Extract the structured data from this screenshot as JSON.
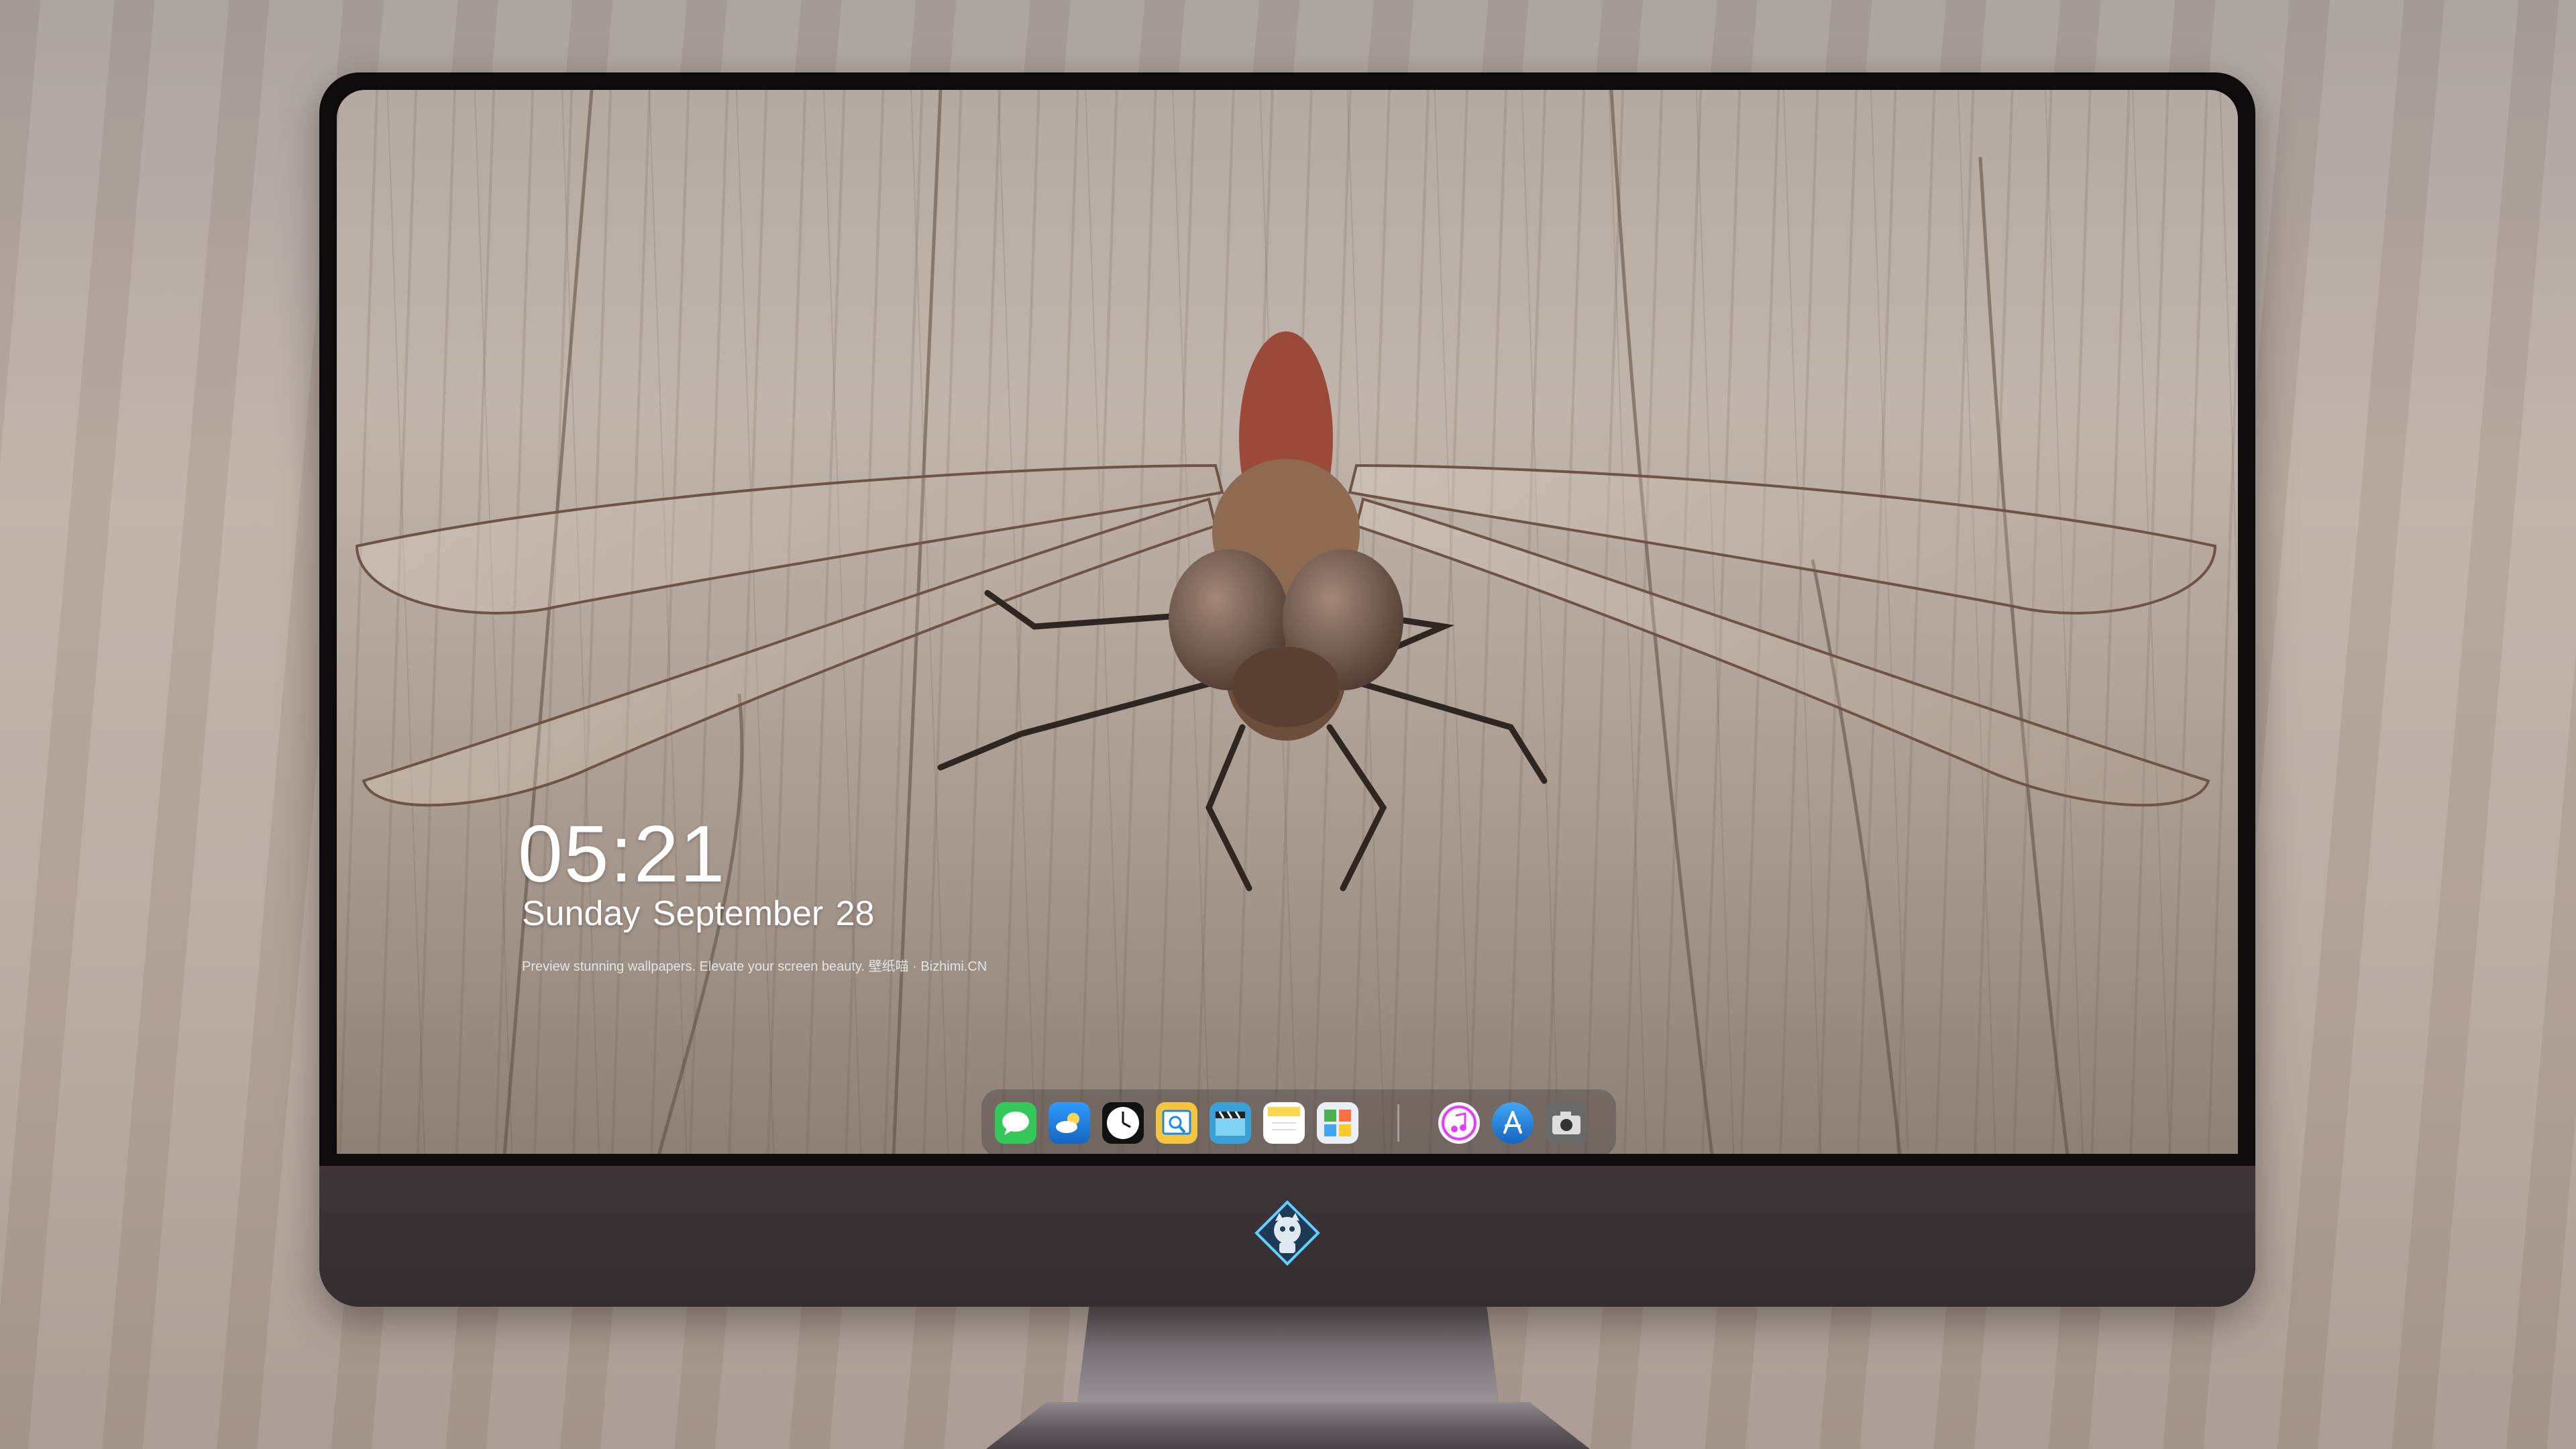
{
  "lock_screen": {
    "time": "05:21",
    "date": "Sunday September   28",
    "caption": "Preview stunning wallpapers. Elevate your screen beauty. 壁纸喵 · Bizhimi.CN"
  },
  "dock": {
    "apps": [
      {
        "name": "Messages",
        "icon": "messages-icon",
        "color": "#34c759"
      },
      {
        "name": "Weather",
        "icon": "weather-icon",
        "color": "#1e88e5"
      },
      {
        "name": "Clock",
        "icon": "clock-icon",
        "color": "#111111"
      },
      {
        "name": "Preview",
        "icon": "preview-icon",
        "color": "#f5c542"
      },
      {
        "name": "Clips",
        "icon": "clapperboard-icon",
        "color": "#3aa0d8"
      },
      {
        "name": "Notes",
        "icon": "notes-icon",
        "color": "#ffd54f"
      },
      {
        "name": "Photo Booth",
        "icon": "photos-icon",
        "color": "#4caf50"
      },
      {
        "name": "iTunes",
        "icon": "music-icon",
        "color": "#e040fb"
      },
      {
        "name": "App Store",
        "icon": "appstore-icon",
        "color": "#1e88e5"
      },
      {
        "name": "Camera",
        "icon": "camera-icon",
        "color": "#555555"
      }
    ]
  },
  "monitor": {
    "logo": "mascot-logo"
  }
}
